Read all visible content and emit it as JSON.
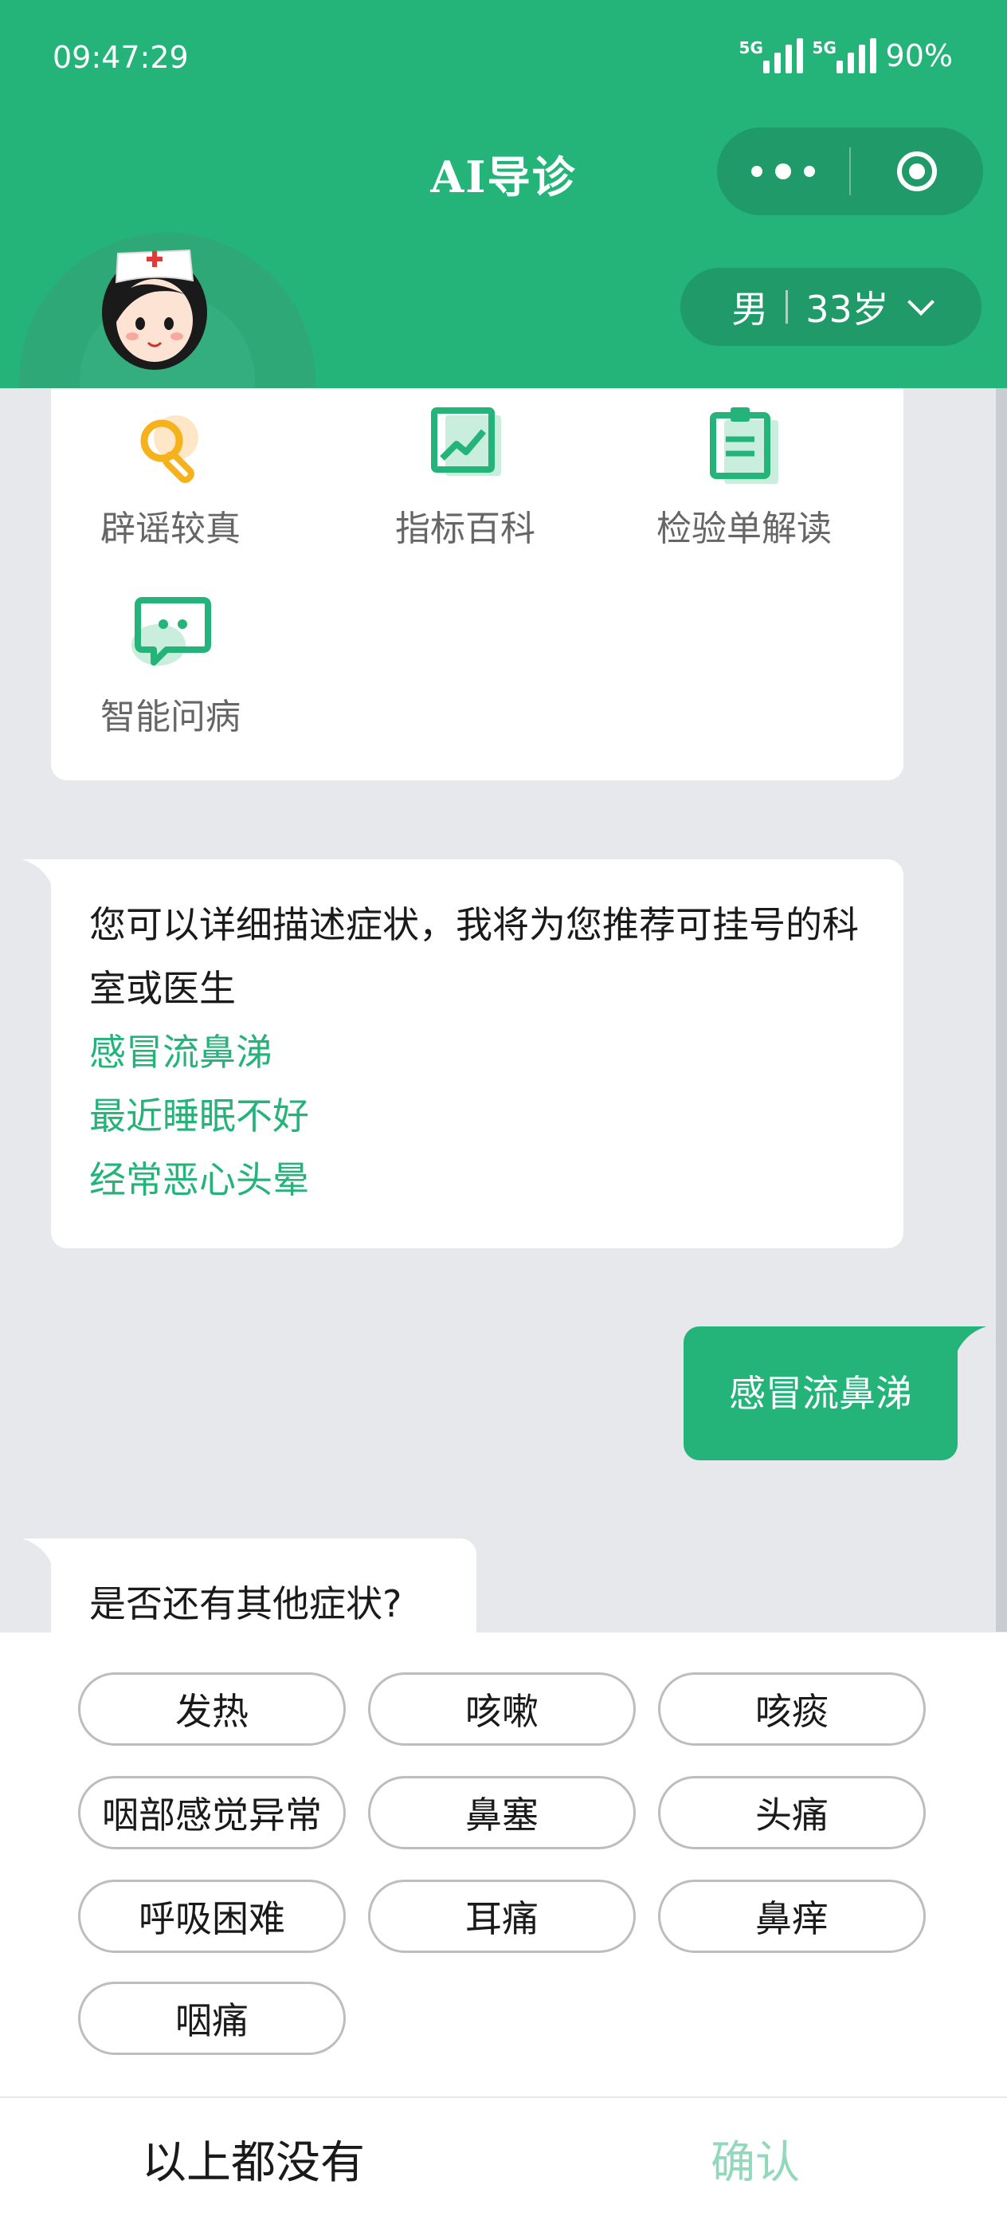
{
  "status_bar": {
    "time": "09:47:29",
    "network1": "5G",
    "network2": "5G",
    "battery": "90%"
  },
  "header": {
    "title": "AI导诊"
  },
  "profile": {
    "gender": "男",
    "age": "33岁"
  },
  "colors": {
    "brand": "#24b47a",
    "brand_dark": "#1f9a68",
    "confirm_disabled": "#92d8bb"
  },
  "tools": [
    {
      "label": "辟谣较真",
      "icon": "magnifier-icon"
    },
    {
      "label": "指标百科",
      "icon": "chart-icon"
    },
    {
      "label": "检验单解读",
      "icon": "clipboard-icon"
    },
    {
      "label": "智能问病",
      "icon": "chat-icon"
    }
  ],
  "messages": {
    "intro": "您可以详细描述症状，我将为您推荐可挂号的科室或医生",
    "suggestions": [
      "感冒流鼻涕",
      "最近睡眠不好",
      "经常恶心头晕"
    ],
    "user_reply": "感冒流鼻涕",
    "question": "是否还有其他症状?"
  },
  "symptoms": [
    "发热",
    "咳嗽",
    "咳痰",
    "咽部感觉异常",
    "鼻塞",
    "头痛",
    "呼吸困难",
    "耳痛",
    "鼻痒",
    "咽痛"
  ],
  "actions": {
    "none": "以上都没有",
    "confirm": "确认"
  }
}
